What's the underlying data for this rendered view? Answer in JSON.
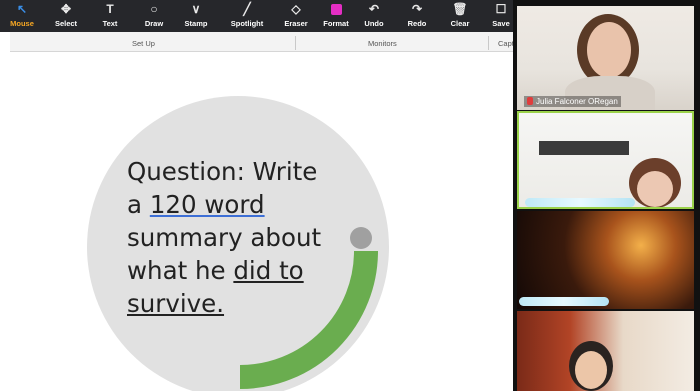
{
  "toolbar": {
    "tools": [
      {
        "label": "Mouse",
        "icon": "mouse-pointer-icon",
        "active": true
      },
      {
        "label": "Select",
        "icon": "select-icon"
      },
      {
        "label": "Text",
        "icon": "text-icon"
      },
      {
        "label": "Draw",
        "icon": "draw-icon"
      },
      {
        "label": "Stamp",
        "icon": "stamp-icon"
      },
      {
        "label": "Spotlight",
        "icon": "spotlight-icon"
      },
      {
        "label": "Eraser",
        "icon": "eraser-icon"
      },
      {
        "label": "Format",
        "icon": "format-icon"
      },
      {
        "label": "Undo",
        "icon": "undo-icon"
      },
      {
        "label": "Redo",
        "icon": "redo-icon"
      },
      {
        "label": "Clear",
        "icon": "clear-icon"
      },
      {
        "label": "Save",
        "icon": "save-icon"
      }
    ]
  },
  "ribbon": {
    "groups": [
      "Set Up",
      "Monitors",
      "Capt"
    ]
  },
  "slide": {
    "question_lines": {
      "l1": "Question: Write",
      "l2a": "a ",
      "l2b": "120 word",
      "l3": "summary about",
      "l4a": "what he ",
      "l4b": "did to",
      "l5": "survive."
    },
    "colors": {
      "arc": "#6aad4f",
      "circle": "#e1e1e1",
      "dot": "#a0a0a0"
    }
  },
  "gallery": {
    "participants": [
      {
        "name": "Julia Falconer ORegan",
        "muted": true
      },
      {
        "name": "",
        "active_speaker": true
      },
      {
        "name": ""
      },
      {
        "name": ""
      }
    ]
  }
}
